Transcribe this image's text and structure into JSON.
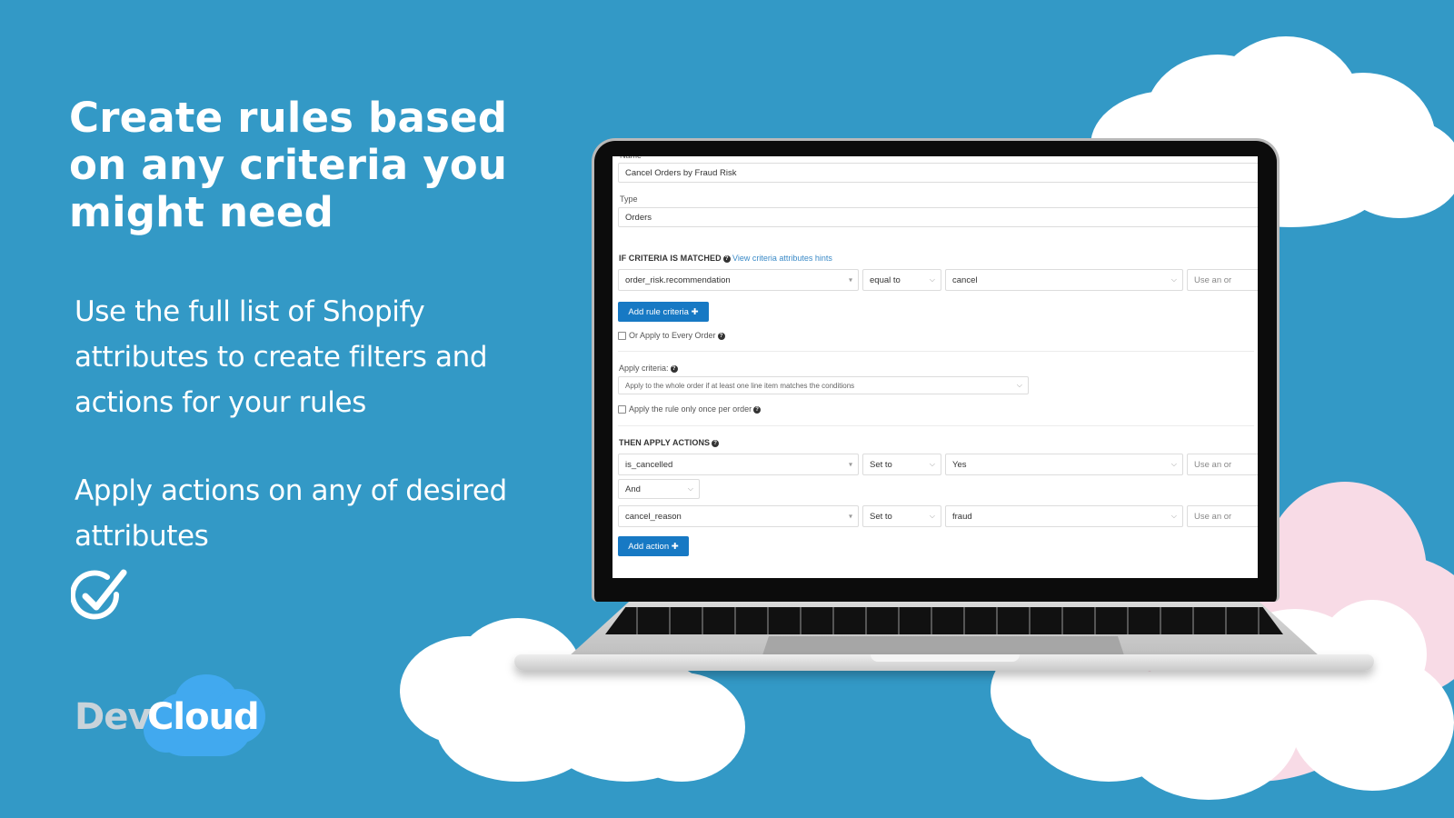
{
  "colors": {
    "background": "#3399c6",
    "primary_button": "#1779c4",
    "link": "#3a8ac7",
    "cloud_white": "#ffffff",
    "cloud_pink": "#f8dbe6",
    "logo_cloud": "#41a9ef"
  },
  "headline": "Create rules based on any criteria you might need",
  "paragraphs": [
    "Use the full list of Shopify attributes to create filters and actions for your rules",
    "Apply actions on any of desired attributes"
  ],
  "icons": {
    "check": "check-circle-icon"
  },
  "logo": {
    "part1": "Dev",
    "part2": "Cloud"
  },
  "form": {
    "name_label": "Name",
    "name_value": "Cancel Orders by Fraud Risk",
    "type_label": "Type",
    "type_value": "Orders",
    "criteria_heading": "IF CRITERIA IS MATCHED",
    "criteria_hint_link": "View criteria attributes hints",
    "criteria": [
      {
        "attribute": "order_risk.recommendation",
        "operator": "equal to",
        "value": "cancel",
        "extra": "Use an or"
      }
    ],
    "add_criteria_button": "Add rule criteria",
    "apply_every_order_label": "Or Apply to Every Order",
    "apply_criteria_label": "Apply criteria:",
    "apply_criteria_value": "Apply to the whole order if at least one line item matches the conditions",
    "apply_once_label": "Apply the rule only once per order",
    "actions_heading": "THEN APPLY ACTIONS",
    "actions": [
      {
        "attribute": "is_cancelled",
        "operator": "Set to",
        "value": "Yes",
        "extra": "Use an or"
      },
      {
        "attribute": "cancel_reason",
        "operator": "Set to",
        "value": "fraud",
        "extra": "Use an or"
      }
    ],
    "joiner": "And",
    "add_action_button": "Add action",
    "plus_glyph": "✚",
    "help_glyph": "?",
    "caret_glyph": "⌵",
    "small_caret_glyph": "▾"
  }
}
